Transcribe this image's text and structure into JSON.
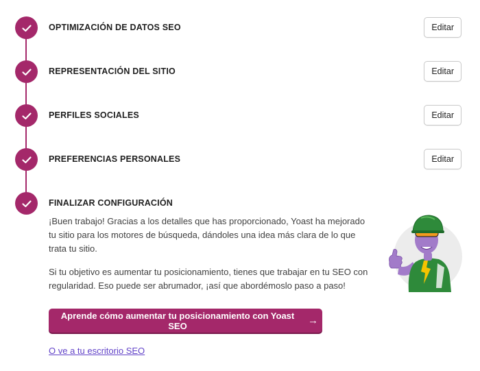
{
  "steps": [
    {
      "title": "OPTIMIZACIÓN DE DATOS SEO",
      "edit_label": "Editar"
    },
    {
      "title": "REPRESENTACIÓN DEL SITIO",
      "edit_label": "Editar"
    },
    {
      "title": "PERFILES SOCIALES",
      "edit_label": "Editar"
    },
    {
      "title": "PREFERENCIAS PERSONALES",
      "edit_label": "Editar"
    },
    {
      "title": "FINALIZAR CONFIGURACIÓN"
    }
  ],
  "finish": {
    "paragraph_1": "¡Buen trabajo! Gracias a los detalles que has proporcionado, Yoast ha mejorado tu sitio para los motores de búsqueda, dándoles una idea más clara de lo que trata tu sitio.",
    "paragraph_2": "Si tu objetivo es aumentar tu posicionamiento, tienes que trabajar en tu SEO con regularidad. Eso puede ser abrumador, ¡así que abordémoslo paso a paso!",
    "cta_label": "Aprende cómo aumentar tu posicionamiento con Yoast SEO",
    "cta_arrow": "→",
    "dashboard_link": "O ve a tu escritorio SEO"
  },
  "colors": {
    "accent": "#a4286a",
    "link": "#6142c8",
    "mascot_purple": "#a27bc9",
    "mascot_green": "#2e8a3a"
  },
  "icons": {
    "step_status": "checkmark-icon",
    "cta": "arrow-right-icon",
    "illustration": "yoast-mascot"
  }
}
